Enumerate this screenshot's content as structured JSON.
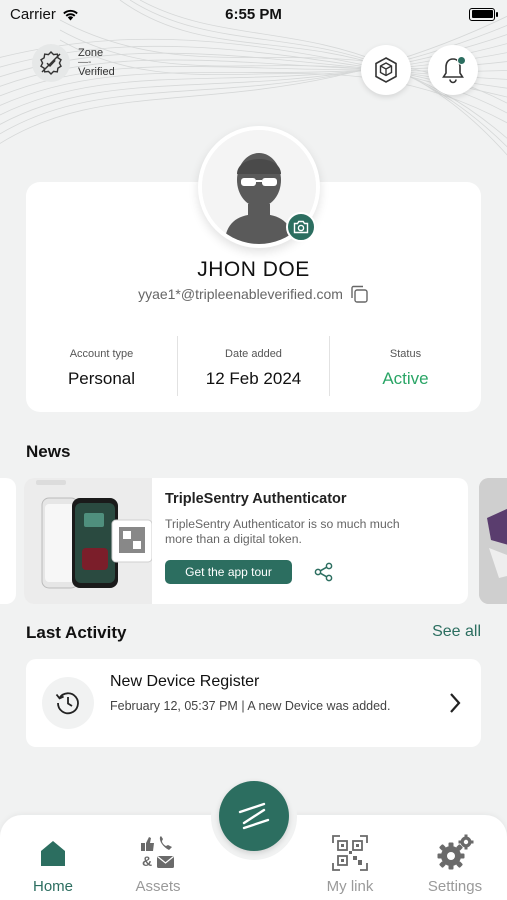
{
  "status_bar": {
    "carrier": "Carrier",
    "time": "6:55 PM"
  },
  "header": {
    "zone_label": "Zone",
    "zone_separator": "—-",
    "zone_status": "Verified",
    "icons": [
      "verified-badge-icon",
      "cube-icon",
      "bell-icon"
    ]
  },
  "profile": {
    "name": "JHON DOE",
    "email": "yyae1*@tripleenableverified.com",
    "account_type_label": "Account type",
    "account_type": "Personal",
    "date_added_label": "Date added",
    "date_added": "12 Feb 2024",
    "status_label": "Status",
    "status": "Active"
  },
  "news": {
    "section_title": "News",
    "card": {
      "title": "TripleSentry Authenticator",
      "description": "TripleSentry Authenticator is so much much more than a digital token.",
      "button_label": "Get the app tour"
    }
  },
  "activity": {
    "section_title": "Last Activity",
    "see_all_label": "See all",
    "items": [
      {
        "title": "New Device Register",
        "subtitle": "February 12, 05:37 PM | A new Device was added."
      }
    ]
  },
  "bottom_nav": {
    "items": [
      {
        "label": "Home",
        "active": true
      },
      {
        "label": "Assets",
        "active": false
      },
      {
        "label": "My link",
        "active": false
      },
      {
        "label": "Settings",
        "active": false
      }
    ]
  },
  "colors": {
    "accent": "#2c6e60",
    "status_active": "#2aa566",
    "background": "#f1f2f2"
  }
}
